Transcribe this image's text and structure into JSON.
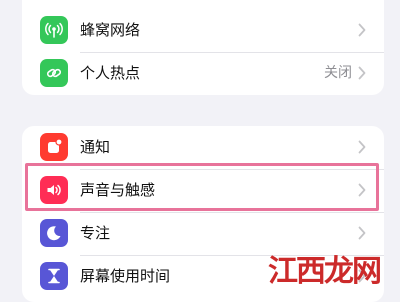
{
  "groups": [
    {
      "rows": [
        {
          "label": "蜂窝网络",
          "icon": "cellular-antenna-icon",
          "icon_color": "#34c759",
          "value": ""
        },
        {
          "label": "个人热点",
          "icon": "personal-hotspot-icon",
          "icon_color": "#34c759",
          "value": "关闭"
        }
      ]
    },
    {
      "rows": [
        {
          "label": "通知",
          "icon": "notification-bell-icon",
          "icon_color": "#ff3b30",
          "value": ""
        },
        {
          "label": "声音与触感",
          "icon": "speaker-icon",
          "icon_color": "#ff2d55",
          "value": "",
          "highlighted": true
        },
        {
          "label": "专注",
          "icon": "moon-icon",
          "icon_color": "#5856d6",
          "value": ""
        },
        {
          "label": "屏幕使用时间",
          "icon": "hourglass-icon",
          "icon_color": "#5856d6",
          "value": ""
        }
      ]
    }
  ],
  "colors": {
    "background": "#f2f2f7",
    "highlight_border": "#e8739a",
    "chevron": "#c4c4c7",
    "watermark": "#cc2a2a"
  },
  "watermark": {
    "text": "江西龙网"
  }
}
